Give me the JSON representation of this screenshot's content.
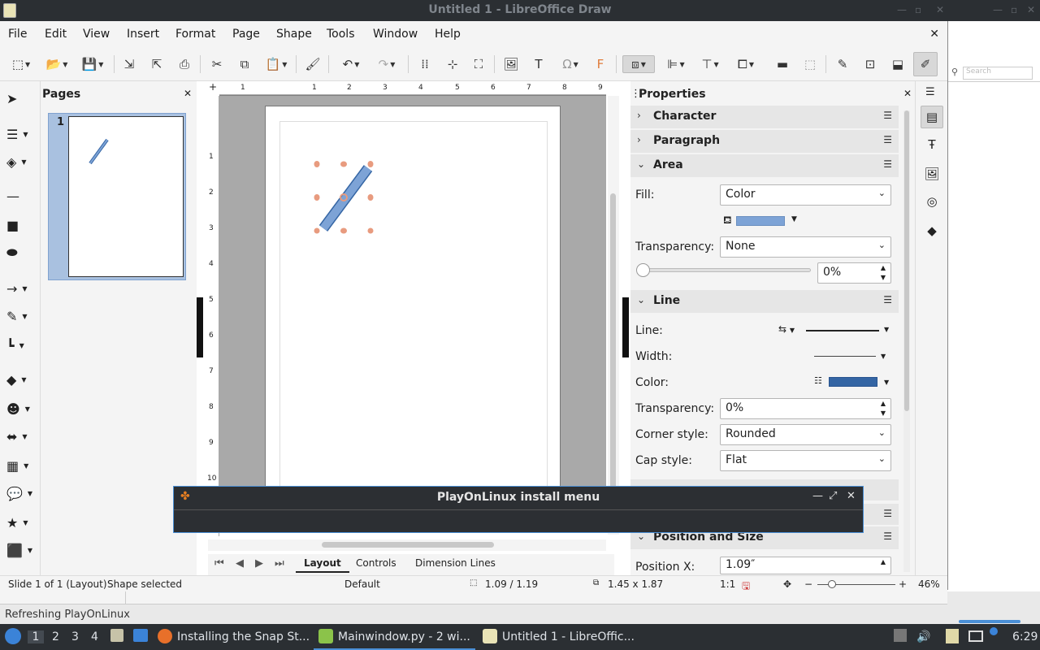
{
  "window": {
    "title": "Untitled 1 - LibreOffice Draw"
  },
  "menu": [
    "File",
    "Edit",
    "View",
    "Insert",
    "Format",
    "Page",
    "Shape",
    "Tools",
    "Window",
    "Help"
  ],
  "pages_pane": {
    "title": "Pages",
    "page_number": "1"
  },
  "rulers": {
    "horizontal": [
      "1",
      "1",
      "2",
      "3",
      "4",
      "5",
      "6",
      "7",
      "8",
      "9"
    ],
    "vertical": [
      "1",
      "2",
      "3",
      "4",
      "5",
      "6",
      "7",
      "8",
      "9",
      "10"
    ]
  },
  "tabs": {
    "layout": "Layout",
    "controls": "Controls",
    "dimension_lines": "Dimension Lines"
  },
  "properties": {
    "title": "Properties",
    "sections": {
      "character": "Character",
      "paragraph": "Paragraph",
      "area": "Area",
      "line": "Line",
      "position": "Position and Size"
    },
    "area": {
      "fill_label": "Fill:",
      "fill_value": "Color",
      "fill_color": "#7da3d6",
      "transparency_label": "Transparency:",
      "transparency_value": "None",
      "transparency_pct": "0%",
      "transparency_slider": 0
    },
    "line": {
      "line_label": "Line:",
      "width_label": "Width:",
      "color_label": "Color:",
      "line_color": "#3465a4",
      "transparency_label": "Transparency:",
      "transparency_value": "0%",
      "corner_label": "Corner style:",
      "corner_value": "Rounded",
      "cap_label": "Cap style:",
      "cap_value": "Flat"
    },
    "position": {
      "x_label": "Position X:",
      "x_value": "1.09″"
    }
  },
  "background_window": {
    "search_placeholder": "Search"
  },
  "status": {
    "slide": "Slide 1 of 1 (Layout)",
    "selection": "Shape selected",
    "master": "Default",
    "position": "1.09 / 1.19",
    "size": "1.45 x 1.87",
    "scale": "1:1",
    "zoom": "46%"
  },
  "desktop_status": "Refreshing PlayOnLinux",
  "pol_window": {
    "title": "PlayOnLinux install menu"
  },
  "taskbar": {
    "workspaces": [
      "1",
      "2",
      "3",
      "4"
    ],
    "tasks": [
      "Installing the Snap St...",
      "Mainwindow.py - 2 wi...",
      "Untitled 1 - LibreOffic..."
    ],
    "clock": "6:29"
  },
  "colors": {
    "shape_fill": "#7da3d6",
    "shape_outline": "#3465a4",
    "handle": "#e89b7f",
    "accent": "#4a8fd6"
  }
}
